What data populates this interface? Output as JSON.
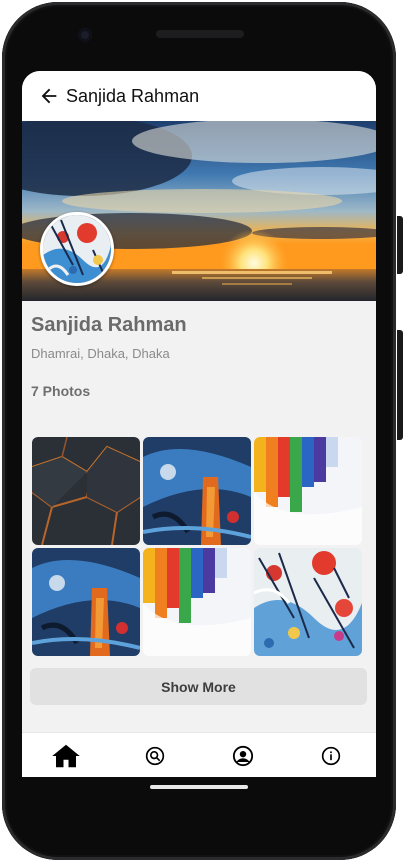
{
  "appbar": {
    "title": "Sanjida Rahman"
  },
  "profile": {
    "name": "Sanjida Rahman",
    "location": "Dhamrai, Dhaka, Dhaka",
    "photos_count_label": "7 Photos"
  },
  "gallery": {
    "photos": [
      {
        "subject": "dark-geometric-cracks"
      },
      {
        "subject": "blue-orange-abstract-paint"
      },
      {
        "subject": "rainbow-paint-drips"
      },
      {
        "subject": "blue-orange-abstract-paint"
      },
      {
        "subject": "rainbow-paint-drips"
      },
      {
        "subject": "colorful-paint-splatter"
      }
    ],
    "show_more_label": "Show More"
  },
  "bottom_nav": {
    "items": [
      {
        "icon": "home-icon",
        "active": true
      },
      {
        "icon": "search-icon",
        "active": false
      },
      {
        "icon": "account-icon",
        "active": false
      },
      {
        "icon": "info-icon",
        "active": false
      }
    ]
  },
  "colors": {
    "screen_background": "#f2f2f2",
    "appbar_background": "#ffffff",
    "show_more_background": "#e1e1e1",
    "name_text": "#6b6b6b"
  }
}
